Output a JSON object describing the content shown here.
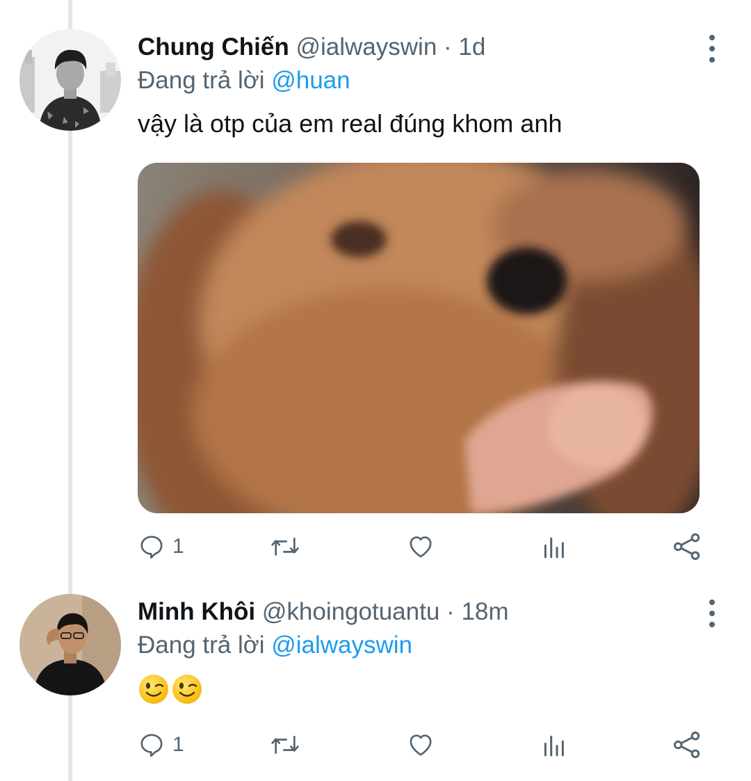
{
  "colors": {
    "handle_grey": "#536471",
    "mention_blue": "#1d9bf0",
    "thread_line": "#e2e6e9"
  },
  "tweets": [
    {
      "author": {
        "name": "Chung Chiến",
        "handle": "@ialwayswin",
        "avatar": "avatar-image"
      },
      "separator": "·",
      "time": "1d",
      "reply_prefix": "Đang trả lời",
      "reply_to": "@huan",
      "text": "vậy là otp của em real đúng khom anh",
      "media": {
        "type": "image",
        "description_icon": "dog-meme-image"
      },
      "actions": {
        "reply_count": "1",
        "retweet_count": "",
        "like_count": ""
      },
      "more_icon": "more-vertical-icon"
    },
    {
      "author": {
        "name": "Minh Khôi",
        "handle": "@khoingotuantu",
        "avatar": "avatar-image"
      },
      "separator": "·",
      "time": "18m",
      "reply_prefix": "Đang trả lời",
      "reply_to": "@ialwayswin",
      "text": "",
      "emojis": [
        "winking-face-emoji",
        "winking-face-emoji"
      ],
      "actions": {
        "reply_count": "1",
        "retweet_count": "",
        "like_count": ""
      },
      "more_icon": "more-vertical-icon"
    }
  ]
}
